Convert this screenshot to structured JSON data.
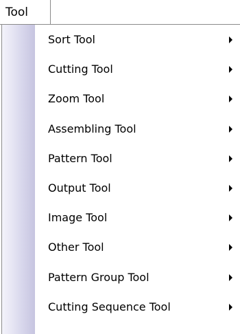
{
  "menubar": {
    "active_menu": "Tool"
  },
  "menu": {
    "items": [
      {
        "label": "Sort Tool",
        "has_submenu": true
      },
      {
        "label": "Cutting Tool",
        "has_submenu": true
      },
      {
        "label": "Zoom Tool",
        "has_submenu": true
      },
      {
        "label": "Assembling Tool",
        "has_submenu": true
      },
      {
        "label": "Pattern Tool",
        "has_submenu": true
      },
      {
        "label": "Output Tool",
        "has_submenu": true
      },
      {
        "label": "Image Tool",
        "has_submenu": true
      },
      {
        "label": "Other Tool",
        "has_submenu": true
      },
      {
        "label": "Pattern Group Tool",
        "has_submenu": true
      },
      {
        "label": "Cutting Sequence Tool",
        "has_submenu": true
      }
    ]
  },
  "icons": {
    "submenu_arrow": "chevron-right-icon"
  },
  "colors": {
    "border": "#8a8a8a",
    "gutter_light": "#f3f3fb",
    "gutter_dark": "#c6c4e0",
    "text": "#000000"
  }
}
